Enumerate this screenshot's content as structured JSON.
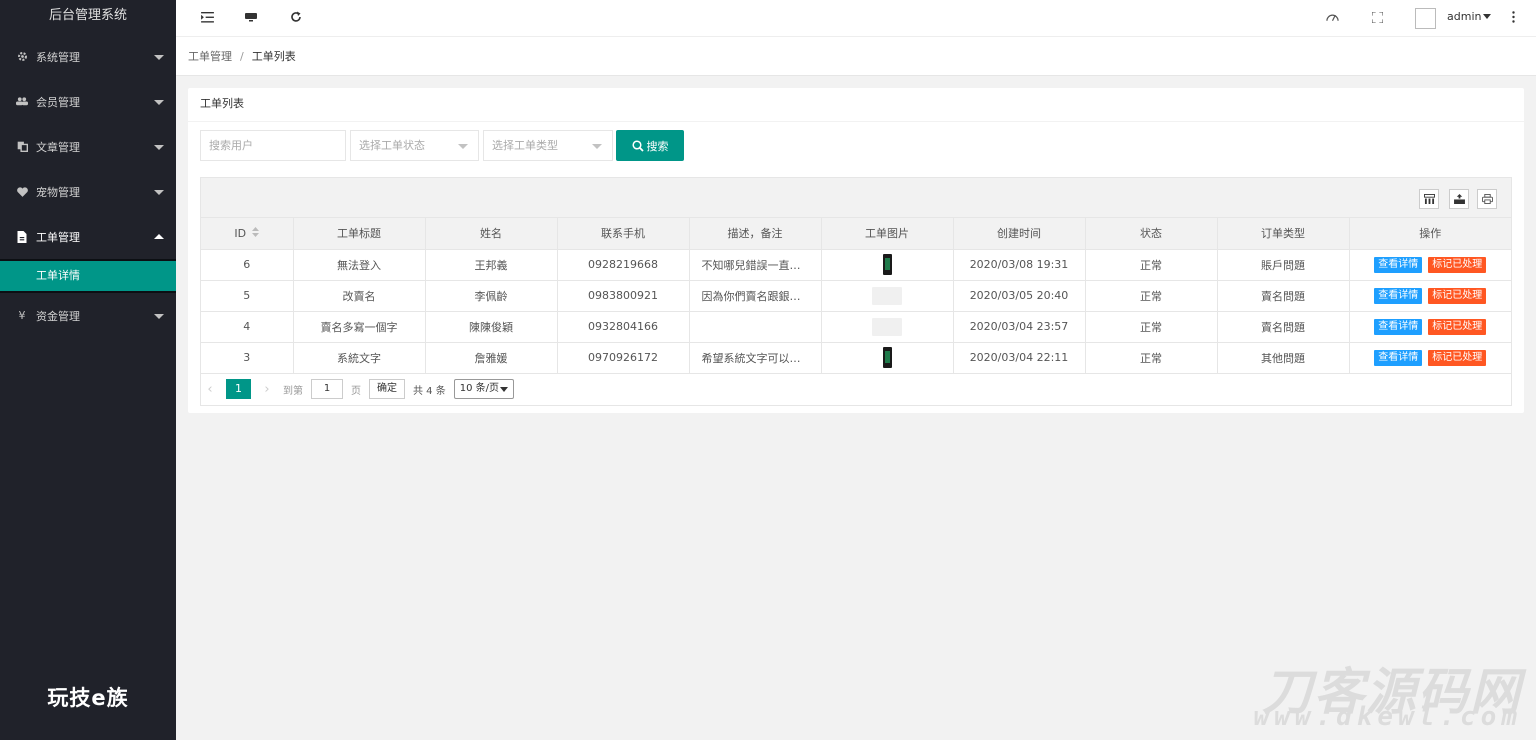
{
  "app": {
    "title": "后台管理系统",
    "brand": "玩技e族"
  },
  "sidebar": {
    "items": [
      {
        "label": "系统管理",
        "icon": "gear-icon"
      },
      {
        "label": "会员管理",
        "icon": "users-icon"
      },
      {
        "label": "文章管理",
        "icon": "documents-icon"
      },
      {
        "label": "宠物管理",
        "icon": "heart-icon"
      },
      {
        "label": "工单管理",
        "icon": "file-icon",
        "open": true,
        "children": [
          {
            "label": "工单详情",
            "active": true
          }
        ]
      },
      {
        "label": "资金管理",
        "icon": "yen-icon"
      }
    ]
  },
  "header": {
    "user": "admin",
    "icons": [
      "menu-fold-icon",
      "monitor-icon",
      "refresh-icon",
      "theme-icon",
      "fullscreen-icon",
      "more-icon"
    ]
  },
  "breadcrumb": {
    "parent": "工单管理",
    "separator": "/",
    "current": "工单列表"
  },
  "card": {
    "title": "工单列表"
  },
  "search": {
    "user_placeholder": "搜索用户",
    "status_placeholder": "选择工单状态",
    "type_placeholder": "选择工单类型",
    "button": "搜索"
  },
  "table": {
    "columns": [
      "ID",
      "工单标题",
      "姓名",
      "联系手机",
      "描述，备注",
      "工单图片",
      "创建时间",
      "状态",
      "订单类型",
      "操作"
    ],
    "rows": [
      {
        "id": "6",
        "title": "無法登入",
        "name": "王邦義",
        "phone": "0928219668",
        "desc": "不知哪兒錯誤一直…",
        "image": "phone",
        "created": "2020/03/08 19:31",
        "status": "正常",
        "type": "賬戶問題"
      },
      {
        "id": "5",
        "title": "改賣名",
        "name": "李佩齡",
        "phone": "0983800921",
        "desc": "因為你們賣名跟銀…",
        "image": "placeholder",
        "created": "2020/03/05 20:40",
        "status": "正常",
        "type": "賣名問題"
      },
      {
        "id": "4",
        "title": "賣名多寫一個字",
        "name": "陳陳俊穎",
        "phone": "0932804166",
        "desc": "",
        "image": "placeholder",
        "created": "2020/03/04 23:57",
        "status": "正常",
        "type": "賣名問題"
      },
      {
        "id": "3",
        "title": "系統文字",
        "name": "詹雅媛",
        "phone": "0970926172",
        "desc": "希望系統文字可以…",
        "image": "phone",
        "created": "2020/03/04 22:11",
        "status": "正常",
        "type": "其他問題"
      }
    ],
    "action_view": "查看详情",
    "action_mark": "标记已处理"
  },
  "pagination": {
    "current": "1",
    "goto_label": "到第",
    "goto_value": "1",
    "page_label": "页",
    "confirm": "确定",
    "total": "共 4 条",
    "page_size": "10 条/页"
  },
  "watermark": {
    "line1": "刀客源码网",
    "line2": "www.dkewl.com"
  },
  "colors": {
    "sidebar": "#20222a",
    "accent": "#009688",
    "blue": "#1e9fff",
    "orange": "#ff5722"
  }
}
